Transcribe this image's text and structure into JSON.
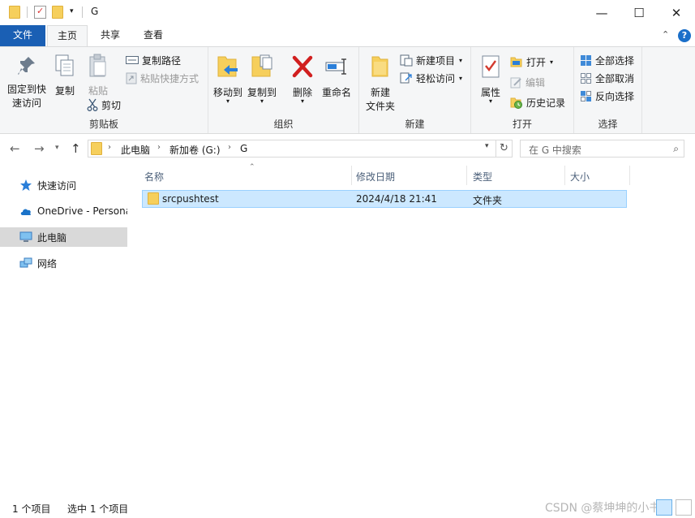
{
  "window": {
    "title": "G",
    "minimize_glyph": "—",
    "maximize_glyph": "☐",
    "close_glyph": "✕"
  },
  "tabs": {
    "file": "文件",
    "home": "主页",
    "share": "共享",
    "view": "查看",
    "collapse_glyph": "⌃",
    "help_glyph": "?"
  },
  "ribbon": {
    "clipboard": {
      "group": "剪贴板",
      "pin_line1": "固定到快",
      "pin_line2": "速访问",
      "copy": "复制",
      "paste": "粘贴",
      "copy_path": "复制路径",
      "paste_shortcut": "粘贴快捷方式",
      "cut": "剪切"
    },
    "organize": {
      "group": "组织",
      "move_to": "移动到",
      "copy_to": "复制到",
      "delete": "删除",
      "rename": "重命名"
    },
    "new": {
      "group": "新建",
      "new_folder_line1": "新建",
      "new_folder_line2": "文件夹",
      "new_item": "新建项目",
      "easy_access": "轻松访问"
    },
    "open": {
      "group": "打开",
      "properties": "属性",
      "open": "打开",
      "edit": "编辑",
      "history": "历史记录"
    },
    "select": {
      "group": "选择",
      "select_all": "全部选择",
      "select_none": "全部取消",
      "invert": "反向选择"
    }
  },
  "address": {
    "crumbs": [
      "此电脑",
      "新加卷 (G:)",
      "G"
    ],
    "search_placeholder": "在 G 中搜索"
  },
  "nav": {
    "quick_access": "快速访问",
    "onedrive": "OneDrive - Persona",
    "this_pc": "此电脑",
    "network": "网络"
  },
  "columns": {
    "name": "名称",
    "modified": "修改日期",
    "type": "类型",
    "size": "大小"
  },
  "files": [
    {
      "name": "srcpushtest",
      "modified": "2024/4/18 21:41",
      "type": "文件夹",
      "size": ""
    }
  ],
  "status": {
    "count": "1 个项目",
    "selected": "选中 1 个项目",
    "watermark": "CSDN @蔡坤坤的小书屋"
  },
  "colors": {
    "accent": "#1a5fb4",
    "selection": "#cce8ff",
    "folder": "#f6cf5c"
  }
}
